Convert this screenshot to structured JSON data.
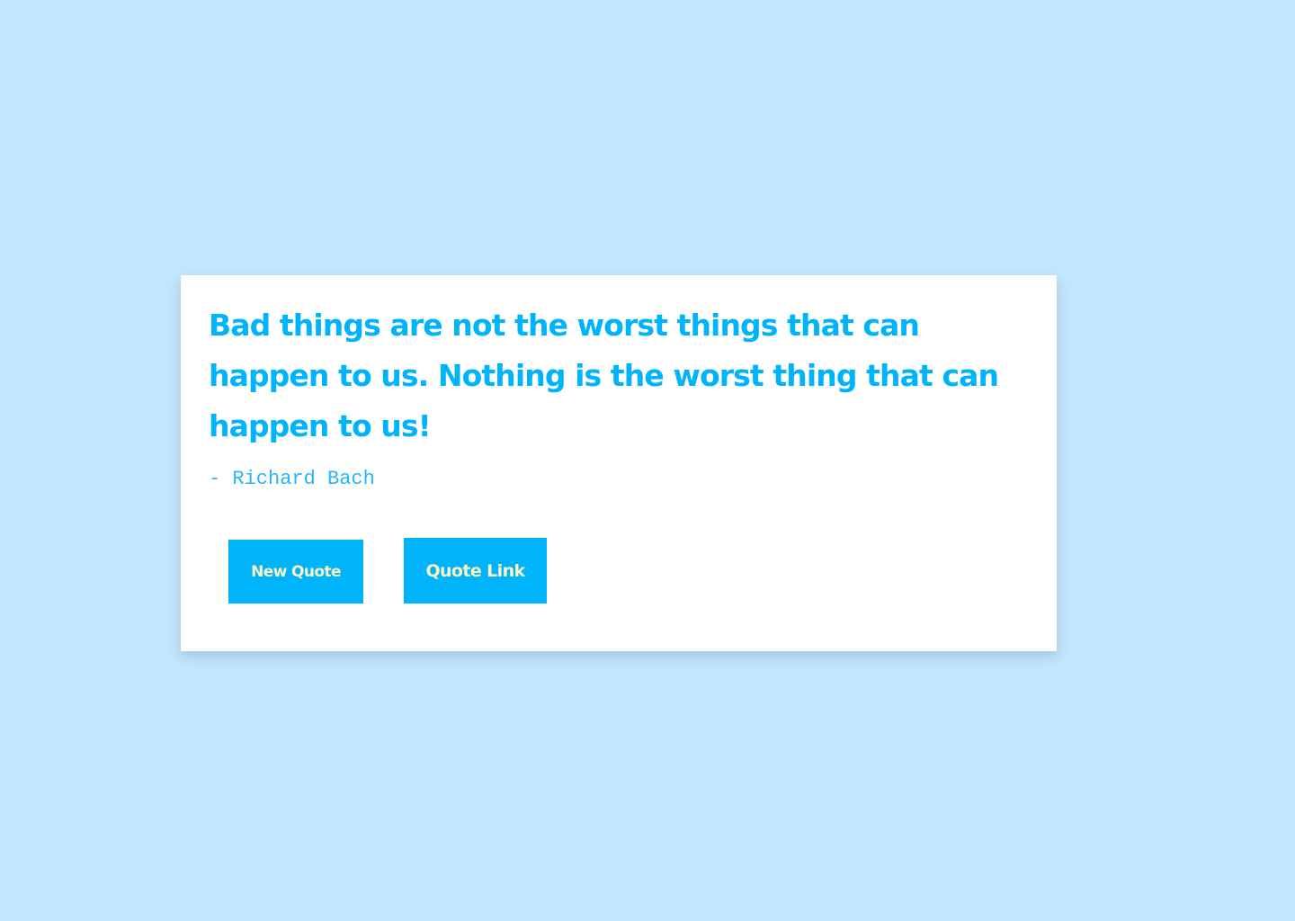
{
  "colors": {
    "background": "#c4e7fe",
    "card": "#ffffff",
    "accent": "#00b4fb",
    "button_text": "#fbf5c6"
  },
  "quote": {
    "text": "Bad things are not the worst things that can happen to us. Nothing is the worst thing that can happen to us!",
    "author": "- Richard Bach"
  },
  "buttons": {
    "new_quote_label": "New Quote",
    "quote_link_label": "Quote Link"
  }
}
